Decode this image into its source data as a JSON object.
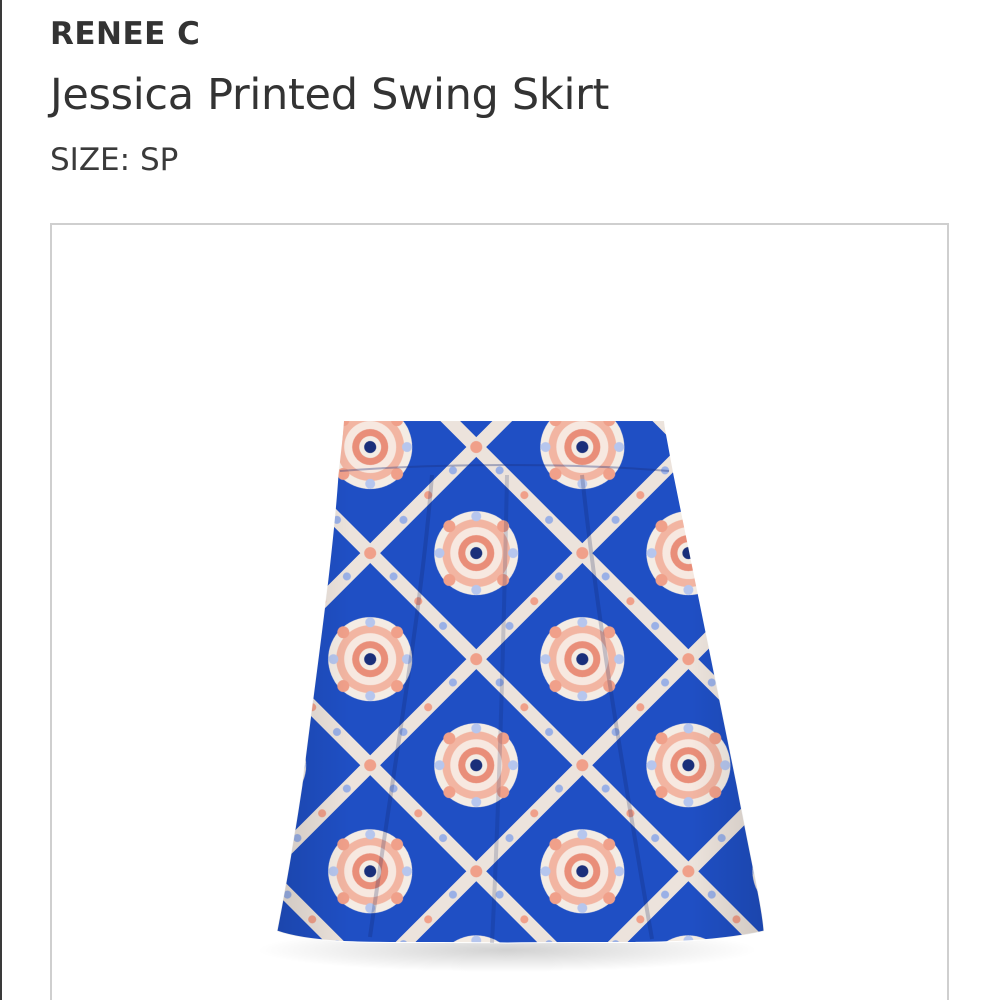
{
  "product": {
    "brand": "RENEE C",
    "name": "Jessica Printed Swing Skirt",
    "size": "SIZE: SP"
  },
  "image": {
    "subject": "skirt",
    "colors": {
      "primary_blue": "#1f4fc4",
      "coral": "#f0a08a",
      "cream": "#f4ece4",
      "navy": "#1a2f7a",
      "frame_border": "#cfcfcf"
    }
  }
}
